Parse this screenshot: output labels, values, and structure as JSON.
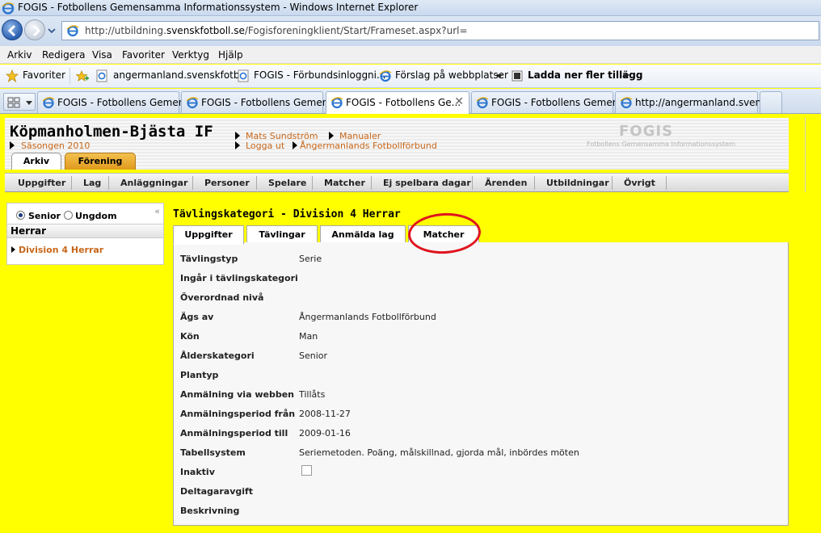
{
  "browser": {
    "window_title": "FOGIS - Fotbollens Gemensamma Informationssystem - Windows Internet Explorer",
    "url_prefix": "http://utbildning.",
    "url_domain": "svenskfotboll.se",
    "url_path": "/Fogisforeningklient/Start/Frameset.aspx?url=",
    "menu": [
      "Arkiv",
      "Redigera",
      "Visa",
      "Favoriter",
      "Verktyg",
      "Hjälp"
    ],
    "favorites": {
      "favorites_label": "Favoriter",
      "items": [
        "angermanland.svenskfotb...",
        "FOGIS - Förbundsinloggni...",
        "Förslag på webbplatser",
        "Ladda ner fler tillägg"
      ]
    },
    "tabs": [
      {
        "label": "FOGIS - Fotbollens Gemen...",
        "active": false
      },
      {
        "label": "FOGIS - Fotbollens Gemen...",
        "active": false
      },
      {
        "label": "FOGIS - Fotbollens Ge...",
        "active": true
      },
      {
        "label": "FOGIS - Fotbollens Gemen...",
        "active": false
      },
      {
        "label": "http://angermanland.sven...",
        "active": false
      }
    ],
    "close_glyph": "✕"
  },
  "header": {
    "club_name": "Köpmanholmen-Bjästa IF",
    "season": "Säsongen 2010",
    "user_link": "Mats Sundström",
    "manuals_link": "Manualer",
    "logout_link": "Logga ut",
    "federation_link": "Ångermanlands Fotbollförbund",
    "logo_text": "FOGIS",
    "logo_sub": "Fotbollens Gemensamma Informationssystem",
    "section_tabs": [
      "Arkiv",
      "Förening"
    ]
  },
  "main_menu": [
    "Uppgifter",
    "Lag",
    "Anläggningar",
    "Personer",
    "Spelare",
    "Matcher",
    "Ej spelbara dagar",
    "Ärenden",
    "Utbildningar",
    "Övrigt"
  ],
  "left_panel": {
    "radio_senior": "Senior",
    "radio_youth": "Ungdom",
    "collapse_glyph": "«",
    "group": "Herrar",
    "competition": "Division 4 Herrar"
  },
  "content": {
    "title": "Tävlingskategori - Division 4 Herrar",
    "tabs": [
      "Uppgifter",
      "Tävlingar",
      "Anmälda lag",
      "Matcher"
    ],
    "fields": [
      {
        "label": "Tävlingstyp",
        "value": "Serie"
      },
      {
        "label": "Ingår i tävlingskategori",
        "value": ""
      },
      {
        "label": "Överordnad nivå",
        "value": ""
      },
      {
        "label": "Ägs av",
        "value": "Ångermanlands Fotbollförbund"
      },
      {
        "label": "Kön",
        "value": "Man"
      },
      {
        "label": "Ålderskategori",
        "value": "Senior"
      },
      {
        "label": "Plantyp",
        "value": ""
      },
      {
        "label": "Anmälning via webben",
        "value": "Tillåts"
      },
      {
        "label": "Anmälningsperiod från",
        "value": "2008-11-27"
      },
      {
        "label": "Anmälningsperiod till",
        "value": "2009-01-16"
      },
      {
        "label": "Tabellsystem",
        "value": "Seriemetoden. Poäng, målskillnad, gjorda mål, inbördes möten"
      },
      {
        "label": "Inaktiv",
        "value": ""
      },
      {
        "label": "Deltagaravgift",
        "value": ""
      },
      {
        "label": "Beskrivning",
        "value": ""
      }
    ]
  }
}
